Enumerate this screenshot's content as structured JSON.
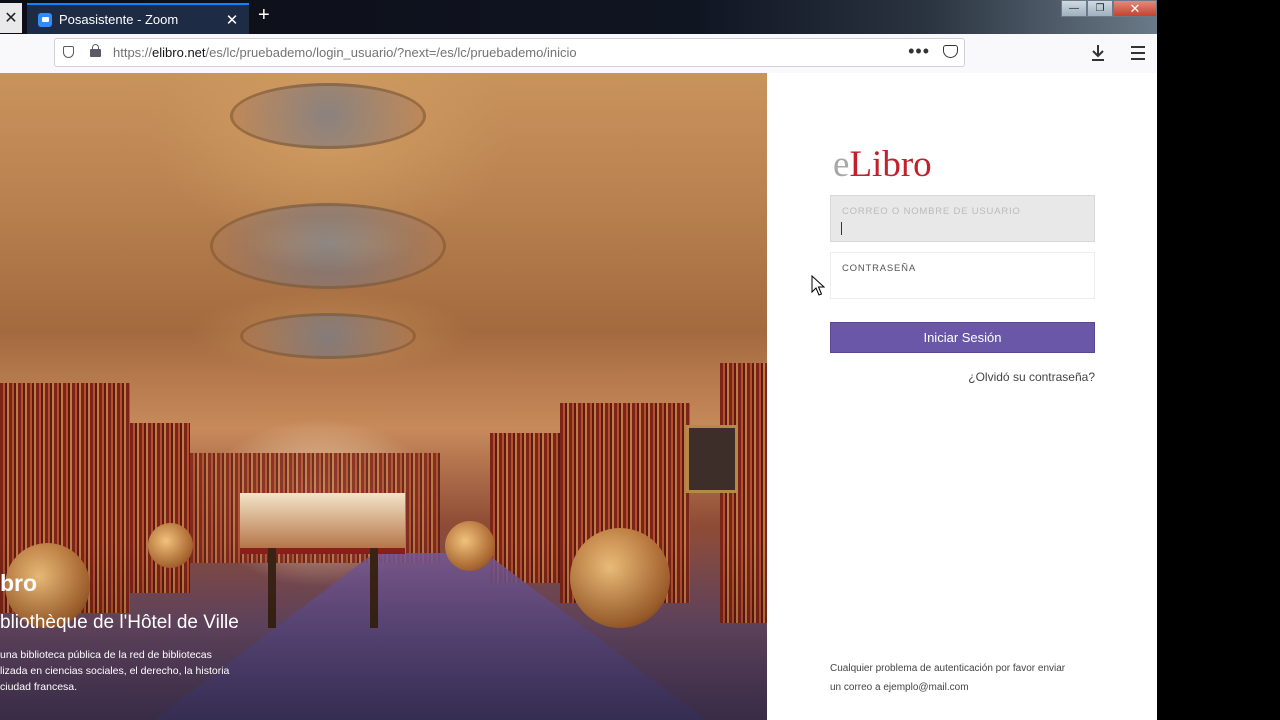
{
  "browser": {
    "tabs": [
      {
        "title": "Posasistente - Zoom"
      }
    ],
    "new_tab_symbol": "+",
    "left_close_symbol": "✕",
    "tab_close_symbol": "✕",
    "url_prefix": "https://",
    "url_domain": "elibro.net",
    "url_path": "/es/lc/pruebademo/login_usuario/?next=/es/lc/pruebademo/inicio",
    "url_more_symbol": "•••",
    "window_controls": {
      "minimize": "—",
      "restore": "❐",
      "close": "✕"
    }
  },
  "hero": {
    "brand": "bro",
    "title": "bliothèque de l'Hôtel de Ville",
    "description_lines": [
      "una biblioteca pública de la red de bibliotecas",
      "lizada en ciencias sociales, el derecho, la historia",
      "ciudad francesa."
    ]
  },
  "login": {
    "logo_e": "e",
    "logo_rest": "Libro",
    "username_label": "CORREO O NOMBRE DE USUARIO",
    "username_value": "",
    "password_label": "CONTRASEÑA",
    "password_value": "",
    "submit_label": "Iniciar Sesión",
    "forgot_label": "¿Olvidó su contraseña?",
    "footnote_line1": "Cualquier problema de autenticación por favor enviar",
    "footnote_line2": "un correo a ejemplo@mail.com"
  },
  "colors": {
    "accent": "#6b57a7",
    "logo_red": "#c2202b",
    "tab_active": "#1d2b44"
  }
}
